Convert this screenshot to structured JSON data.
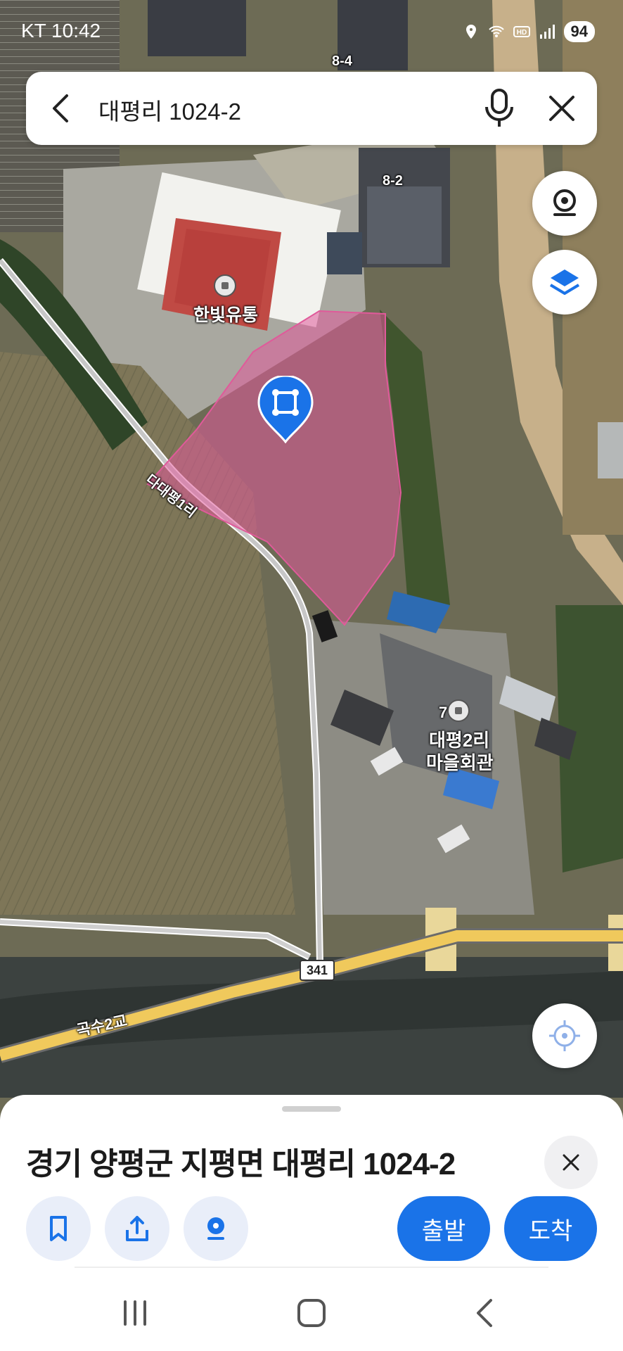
{
  "status_bar": {
    "time": "KT 10:42",
    "battery": "94",
    "icons": [
      "location-icon",
      "wifi-icon",
      "hd-icon",
      "signal-icon",
      "battery-icon"
    ]
  },
  "search": {
    "query": "대평리 1024-2",
    "icons": [
      "back-icon",
      "mic-icon",
      "close-icon"
    ]
  },
  "map": {
    "labels": {
      "building_8_4": "8-4",
      "building_8_2": "8-2",
      "poi_hanbit": "한빛유통",
      "road_name": "다대평1리",
      "poi_hall_line1": "대평2리",
      "poi_hall_line2": "마을회관",
      "poi_hall_num": "7",
      "route_shield": "341",
      "bridge": "곡수2교"
    },
    "colors": {
      "parcel_fill": "#e05a9a",
      "pin": "#1a73e8",
      "road_yellow": "#f0c95c"
    },
    "controls": [
      "street-view-icon",
      "layers-icon",
      "my-location-icon"
    ]
  },
  "bottom_sheet": {
    "address": "경기 양평군 지평면 대평리 1024-2",
    "actions": {
      "save": "bookmark-icon",
      "share": "share-icon",
      "roadview": "roadview-icon",
      "depart_label": "출발",
      "arrive_label": "도착"
    },
    "accent": "#1a73e8"
  },
  "nav_bar": [
    "recents-icon",
    "home-icon",
    "back-icon"
  ]
}
